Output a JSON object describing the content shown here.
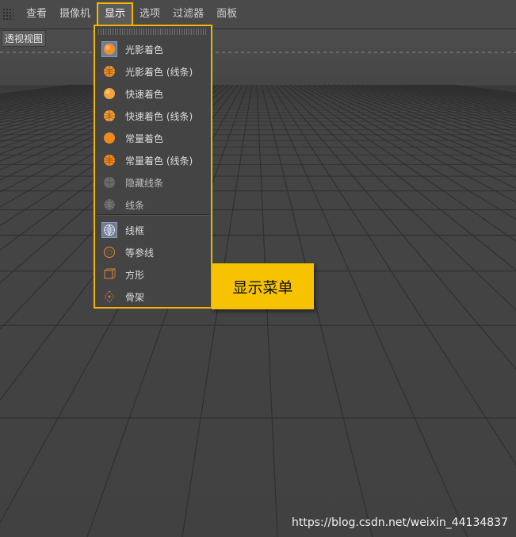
{
  "menubar": {
    "items": [
      "查看",
      "摄像机",
      "显示",
      "选项",
      "过滤器",
      "面板"
    ],
    "active_index": 2
  },
  "viewport": {
    "label": "透视视图"
  },
  "dropdown": {
    "items": [
      {
        "label": "光影着色",
        "icon": "shaded-sphere-icon",
        "selected": true
      },
      {
        "label": "光影着色 (线条)",
        "icon": "shaded-lines-sphere-icon"
      },
      {
        "label": "快速着色",
        "icon": "quick-shaded-sphere-icon"
      },
      {
        "label": "快速着色 (线条)",
        "icon": "quick-shaded-lines-sphere-icon"
      },
      {
        "label": "常量着色",
        "icon": "constant-shaded-sphere-icon"
      },
      {
        "label": "常量着色 (线条)",
        "icon": "constant-shaded-lines-sphere-icon"
      },
      {
        "label": "隐藏线条",
        "icon": "hidden-line-sphere-icon"
      },
      {
        "label": "线条",
        "icon": "lines-sphere-icon"
      },
      {
        "label": "线框",
        "icon": "wireframe-sphere-icon",
        "selected": true
      },
      {
        "label": "等参线",
        "icon": "isoparm-icon"
      },
      {
        "label": "方形",
        "icon": "box-icon"
      },
      {
        "label": "骨架",
        "icon": "skeleton-icon"
      }
    ]
  },
  "callout": {
    "text": "显示菜单"
  },
  "watermark": "https://blog.csdn.net/weixin_44134837",
  "colors": {
    "highlight": "#f2b400",
    "callout_bg": "#f7c200",
    "orange": "#f0902a"
  }
}
